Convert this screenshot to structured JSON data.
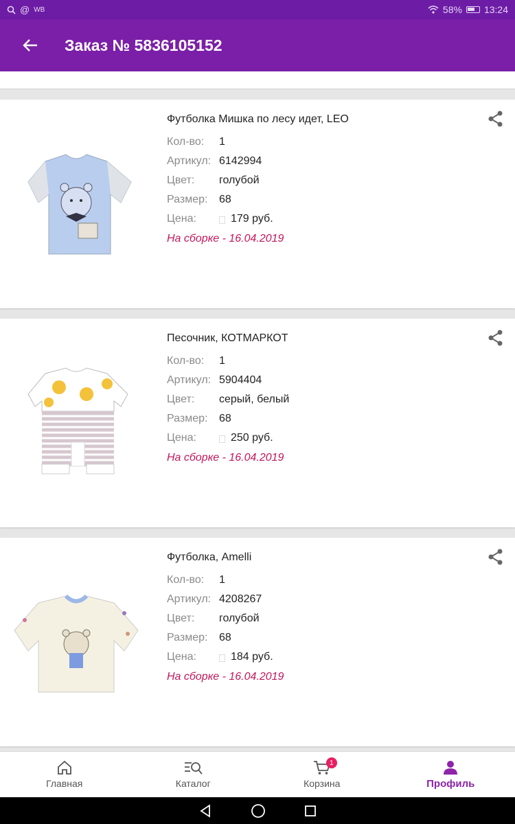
{
  "status_bar": {
    "left_label": "WB",
    "battery": "58%",
    "time": "13:24"
  },
  "header": {
    "title": "Заказ № 5836105152"
  },
  "labels": {
    "qty": "Кол-во:",
    "article": "Артикул:",
    "color": "Цвет:",
    "size": "Размер:",
    "price": "Цена:"
  },
  "items": [
    {
      "title": "Футболка Мишка по лесу идет, LEO",
      "qty": "1",
      "article": "6142994",
      "color": "голубой",
      "size": "68",
      "price": "179 руб.",
      "status": "На сборке - 16.04.2019",
      "image": "tshirt-bear-blue"
    },
    {
      "title": "Песочник, КОТМАРКОТ",
      "qty": "1",
      "article": "5904404",
      "color": "серый, белый",
      "size": "68",
      "price": "250 руб.",
      "status": "На сборке - 16.04.2019",
      "image": "romper-striped"
    },
    {
      "title": "Футболка, Amelli",
      "qty": "1",
      "article": "4208267",
      "color": "голубой",
      "size": "68",
      "price": "184 руб.",
      "status": "На сборке - 16.04.2019",
      "image": "tshirt-bear-cream"
    }
  ],
  "nav": {
    "home": "Главная",
    "catalog": "Каталог",
    "cart": "Корзина",
    "cart_badge": "1",
    "profile": "Профиль"
  },
  "colors": {
    "app_bar": "#7b1fa8",
    "accent": "#8e24aa",
    "status": "#c2185b"
  }
}
